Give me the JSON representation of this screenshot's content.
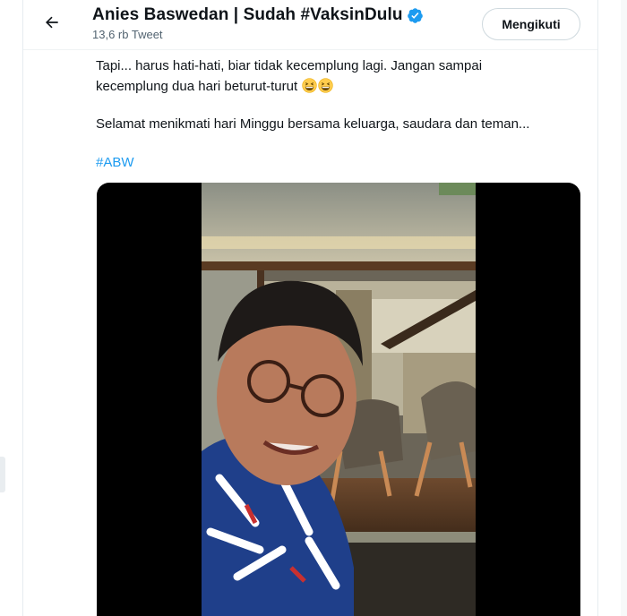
{
  "header": {
    "display_name": "Anies Baswedan | Sudah #VaksinDulu",
    "tweet_count": "13,6 rb Tweet",
    "follow_label": "Mengikuti"
  },
  "tweet": {
    "line1": "Tapi... harus hati-hati, biar tidak kecemplung lagi. Jangan sampai",
    "line2": "kecemplung dua hari beturut-turut",
    "paragraph2": "Selamat menikmati hari Minggu bersama keluarga, saudara dan teman...",
    "hashtag": "#ABW"
  },
  "icons": {
    "back": "arrow-left-icon",
    "verified": "verified-badge-icon",
    "emoji": "grinning-squinting-face-emoji"
  },
  "colors": {
    "accent": "#1d9bf0",
    "text": "#0f1419",
    "secondary_text": "#536471"
  }
}
